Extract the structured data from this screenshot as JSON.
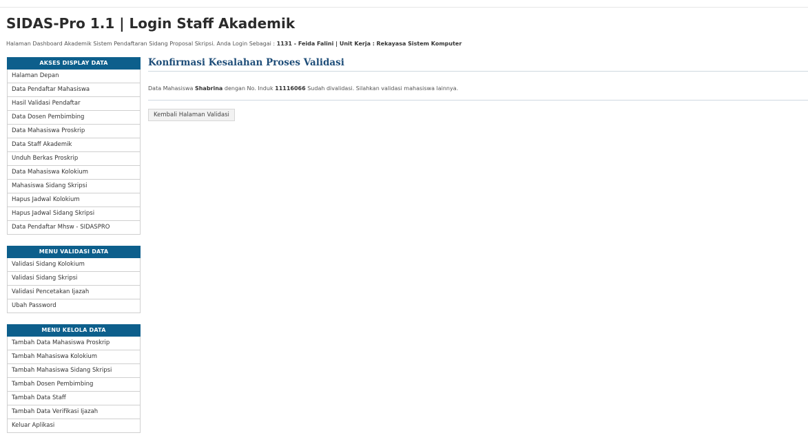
{
  "header": {
    "title": "SIDAS-Pro 1.1 | Login Staff Akademik",
    "subtitle_prefix": "Halaman Dashboard Akademik Sistem Pendaftaran Sidang Proposal Skripsi. Anda Login Sebagai : ",
    "user_id": "1131",
    "user_name": "Feida Falini",
    "unit_label": "Unit Kerja :",
    "unit_name": "Rekayasa Sistem Komputer"
  },
  "sidebar": {
    "groups": [
      {
        "title": "AKSES DISPLAY DATA",
        "items": [
          "Halaman Depan",
          "Data Pendaftar Mahasiswa",
          "Hasil Validasi Pendaftar",
          "Data Dosen Pembimbing",
          "Data Mahasiswa Proskrip",
          "Data Staff Akademik",
          "Unduh Berkas Proskrip",
          "Data Mahasiswa Kolokium",
          "Mahasiswa Sidang Skripsi",
          "Hapus Jadwal Kolokium",
          "Hapus Jadwal Sidang Skripsi",
          "Data Pendaftar Mhsw - SIDASPRO"
        ]
      },
      {
        "title": "MENU VALIDASI DATA",
        "items": [
          "Validasi Sidang Kolokium",
          "Validasi Sidang Skripsi",
          "Validasi Pencetakan Ijazah",
          "Ubah Password"
        ]
      },
      {
        "title": "MENU KELOLA DATA",
        "items": [
          "Tambah Data Mahasiswa Proskrip",
          "Tambah Mahasiswa Kolokium",
          "Tambah Mahasiswa Sidang Skripsi",
          "Tambah Dosen Pembimbing",
          "Tambah Data Staff",
          "Tambah Data Verifikasi Ijazah",
          "Keluar Aplikasi"
        ]
      }
    ]
  },
  "main": {
    "title": "Konfirmasi Kesalahan Proses Validasi",
    "message_part1": "Data Mahasiswa ",
    "student_name": "Shabrina",
    "message_part2": " dengan No. Induk ",
    "student_id": "11116066",
    "message_part3": " Sudah divalidasi. Silahkan validasi mahasiswa lainnya.",
    "back_button_label": "Kembali Halaman Validasi"
  }
}
